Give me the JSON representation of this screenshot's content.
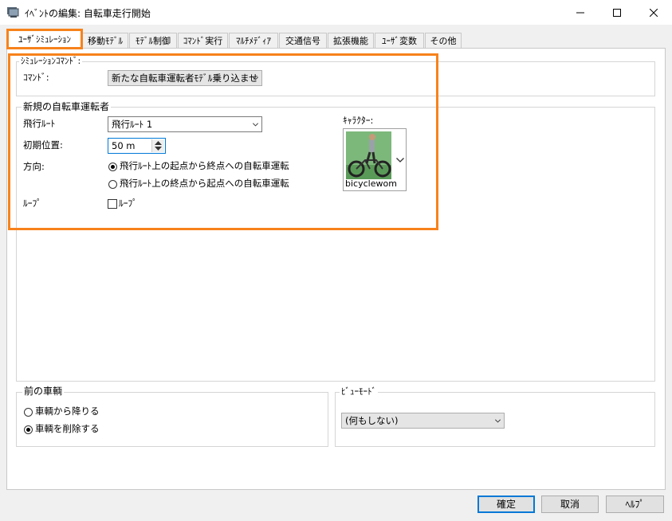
{
  "window": {
    "title": "ｲﾍﾞﾝﾄの編集: 自転車走行開始",
    "minimize_icon": "minimize-icon",
    "maximize_icon": "maximize-icon",
    "close_icon": "close-icon"
  },
  "tabs": [
    {
      "label": "ﾕｰｻﾞｼﾐｭﾚｰｼｮﾝ",
      "active": true
    },
    {
      "label": "移動ﾓﾃﾞﾙ"
    },
    {
      "label": "ﾓﾃﾞﾙ制御"
    },
    {
      "label": "ｺﾏﾝﾄﾞ実行"
    },
    {
      "label": "ﾏﾙﾁﾒﾃﾞｨｱ"
    },
    {
      "label": "交通信号"
    },
    {
      "label": "拡張機能"
    },
    {
      "label": "ﾕｰｻﾞ変数"
    },
    {
      "label": "その他"
    }
  ],
  "sim_command": {
    "group_label": "ｼﾐｭﾚｰｼｮﾝｺﾏﾝﾄﾞ:",
    "command_label": "ｺﾏﾝﾄﾞ:",
    "command_value": "新たな自転車運転者ﾓﾃﾞﾙ乗り込ませ"
  },
  "new_rider": {
    "group_label": "新規の自転車運転者",
    "route_label": "飛行ﾙｰﾄ",
    "route_value": "飛行ﾙｰﾄ 1",
    "position_label": "初期位置:",
    "position_value": "50 m",
    "direction_label": "方向:",
    "direction_options": [
      "飛行ﾙｰﾄ上の起点から終点への自転車運転",
      "飛行ﾙｰﾄ上の終点から起点への自転車運転"
    ],
    "direction_selected": 0,
    "loop_label": "ﾙｰﾌﾟ",
    "loop_checkbox_label": "ﾙｰﾌﾟ",
    "loop_checked": false,
    "character_label": "ｷｬﾗｸﾀｰ:",
    "character_name": "bicyclewom"
  },
  "prev_vehicle": {
    "group_label": "前の車輌",
    "options": [
      "車輌から降りる",
      "車輌を削除する"
    ],
    "selected": 1
  },
  "view_mode": {
    "group_label": "ﾋﾞｭｰﾓｰﾄﾞ",
    "value": "(何もしない)"
  },
  "buttons": {
    "ok": "確定",
    "cancel": "取消",
    "help": "ﾍﾙﾌﾟ"
  },
  "colors": {
    "highlight": "#f7821b",
    "default_button_border": "#0078d7"
  }
}
